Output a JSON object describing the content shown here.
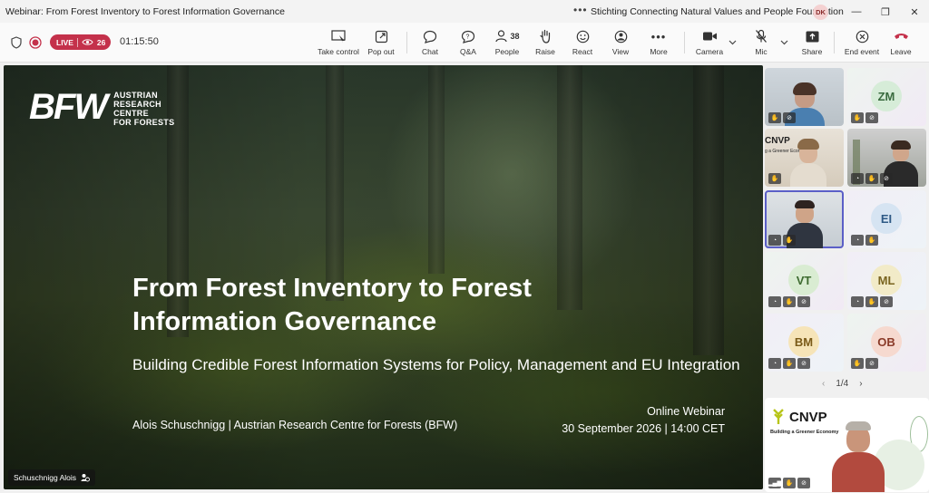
{
  "window": {
    "title": "Webinar: From Forest Inventory to Forest Information Governance",
    "more": "•••",
    "org": "Stichting Connecting Natural Values and People Foundation",
    "user_initials": "DK"
  },
  "toolbar": {
    "live_label": "LIVE",
    "viewers": "26",
    "timer": "01:15:50",
    "people_count": "38",
    "buttons": {
      "take_control": "Take control",
      "pop_out": "Pop out",
      "chat": "Chat",
      "qa": "Q&A",
      "people": "People",
      "raise": "Raise",
      "react": "React",
      "view": "View",
      "more": "More",
      "camera": "Camera",
      "mic": "Mic",
      "share": "Share",
      "end_event": "End event",
      "leave": "Leave"
    }
  },
  "slide": {
    "logo_mark": "BFW",
    "logo_text_1": "AUSTRIAN",
    "logo_text_2": "RESEARCH",
    "logo_text_3": "CENTRE",
    "logo_text_4": "FOR FORESTS",
    "title_line_1": "From Forest Inventory to Forest",
    "title_line_2": "Information Governance",
    "subtitle": "Building Credible Forest Information Systems for Policy, Management and EU Integration",
    "author": "Alois Schuschnigg | Austrian Research Centre for Forests (BFW)",
    "event_line_1": "Online Webinar",
    "event_line_2": "30 September 2026 | 14:00 CET",
    "presenter_name": "Schuschnigg Alois"
  },
  "participants": {
    "tiles": [
      {
        "initials": ""
      },
      {
        "initials": "ZM"
      },
      {
        "initials": "",
        "logo": "CNVP",
        "tagline": "g a Greener Econom"
      },
      {
        "initials": ""
      },
      {
        "initials": ""
      },
      {
        "initials": "EI"
      },
      {
        "initials": "VT"
      },
      {
        "initials": "ML"
      },
      {
        "initials": "BM"
      },
      {
        "initials": "OB"
      }
    ],
    "pager": "1/4",
    "featured": {
      "logo": "CNVP",
      "tagline": "Building a Greener Economy"
    }
  },
  "colors": {
    "live_red": "#c4314b",
    "accent": "#5b5fc7"
  }
}
